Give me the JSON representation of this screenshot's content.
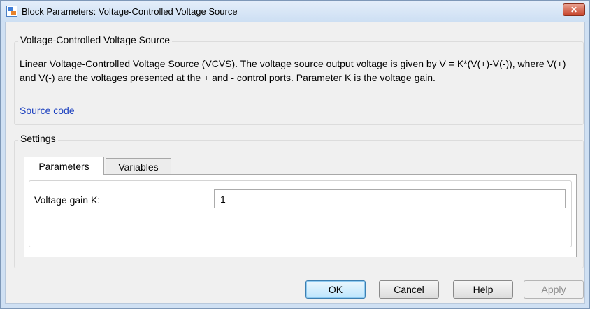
{
  "window": {
    "title": "Block Parameters: Voltage-Controlled Voltage Source",
    "close_label": "✕"
  },
  "block": {
    "name": "Voltage-Controlled Voltage Source",
    "description": "Linear Voltage-Controlled Voltage Source (VCVS). The voltage source output voltage is given by V = K*(V(+)-V(-)), where V(+) and V(-) are the voltages presented at the + and - control ports. Parameter K is the voltage gain.",
    "source_link": "Source code"
  },
  "settings": {
    "title": "Settings",
    "tabs": [
      {
        "label": "Parameters",
        "active": true
      },
      {
        "label": "Variables",
        "active": false
      }
    ],
    "parameters": [
      {
        "label": "Voltage gain K:",
        "value": "1"
      }
    ]
  },
  "buttons": {
    "ok": "OK",
    "cancel": "Cancel",
    "help": "Help",
    "apply": "Apply"
  },
  "icons": {
    "app": "simulink-block-icon",
    "close": "close-icon"
  },
  "colors": {
    "close_button": "#c7432b",
    "link": "#1a3fbf",
    "frame": "#cfe0f3"
  }
}
